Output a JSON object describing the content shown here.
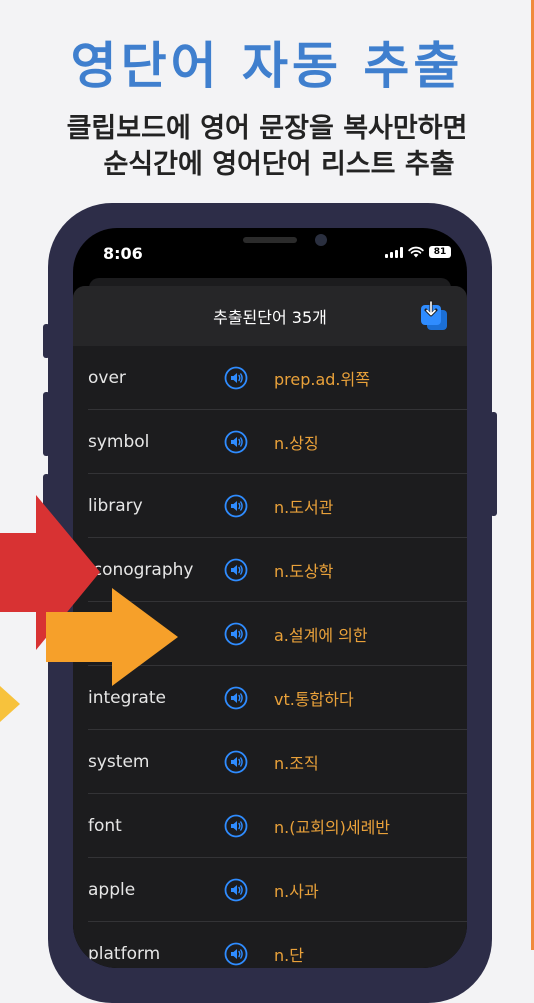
{
  "promo": {
    "title": "영단어 자동 추출",
    "subtitle_line1": "클립보드에 영어 문장을 복사만하면",
    "subtitle_line2": "순식간에 영어단어 리스트 추출"
  },
  "status_bar": {
    "time": "8:06",
    "battery": "81"
  },
  "sheet": {
    "title": "추출된단어 35개",
    "save_icon": "download-icon"
  },
  "words": [
    {
      "word": "over",
      "meaning": "prep.ad.위쪽"
    },
    {
      "word": "symbol",
      "meaning": "n.상징"
    },
    {
      "word": "library",
      "meaning": "n.도서관"
    },
    {
      "word": "iconography",
      "meaning": "n.도상학"
    },
    {
      "word": "",
      "meaning": "a.설계에 의한"
    },
    {
      "word": "integrate",
      "meaning": "vt.통합하다"
    },
    {
      "word": "system",
      "meaning": "n.조직"
    },
    {
      "word": "font",
      "meaning": "n.(교회의)세례반"
    },
    {
      "word": "apple",
      "meaning": "n.사과"
    },
    {
      "word": "platform",
      "meaning": "n.단"
    }
  ],
  "colors": {
    "title": "#3f7fce",
    "meaning": "#e9a13a",
    "speaker_icon": "#2f8cff",
    "red_arrow": "#d83233",
    "orange_arrow": "#f6a02a",
    "yellow_arrow": "#f7c23c"
  }
}
